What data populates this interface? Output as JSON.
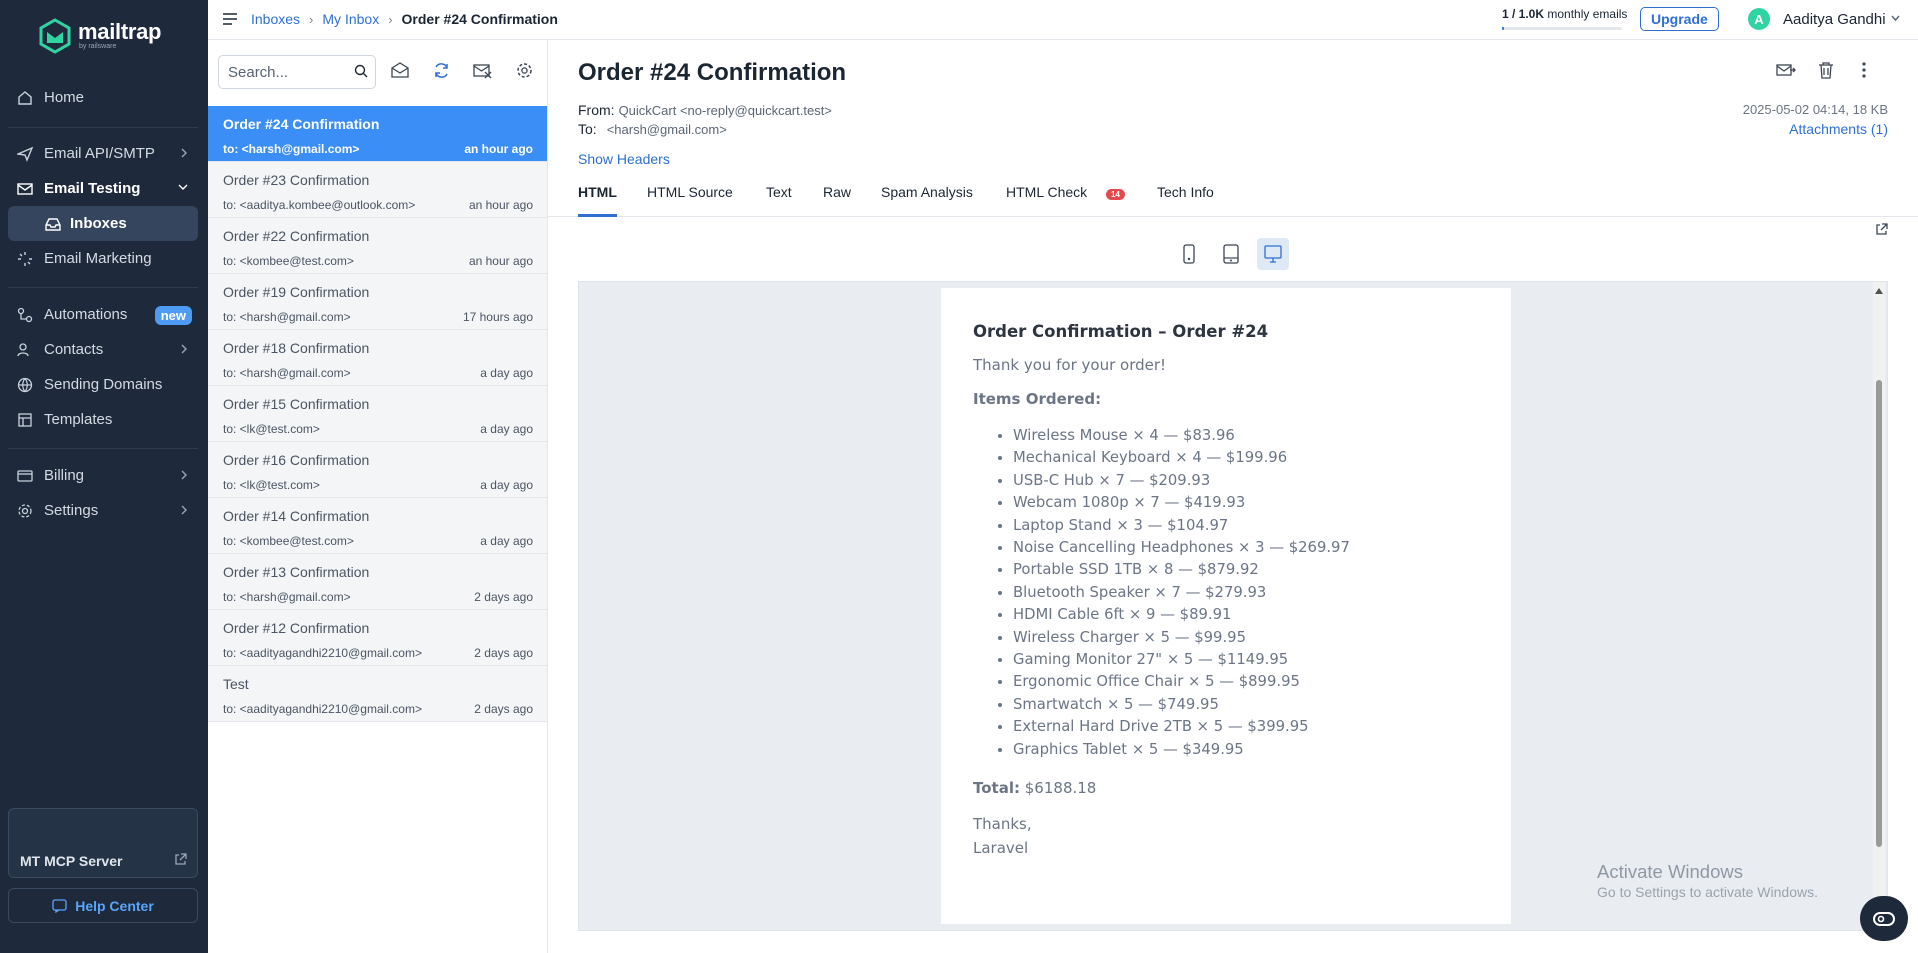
{
  "app": {
    "brand": "mailtrap",
    "brand_sub": "by railsware"
  },
  "sidebar": {
    "items": [
      {
        "label": "Home",
        "icon": "home-icon"
      },
      {
        "label": "Email API/SMTP",
        "icon": "send-icon"
      },
      {
        "label": "Email Testing",
        "icon": "email-testing-icon"
      },
      {
        "label": "Inboxes",
        "icon": "inbox-icon"
      },
      {
        "label": "Email Marketing",
        "icon": "marketing-icon"
      },
      {
        "label": "Automations",
        "icon": "automation-icon",
        "badge": "new"
      },
      {
        "label": "Contacts",
        "icon": "contacts-icon"
      },
      {
        "label": "Sending Domains",
        "icon": "globe-icon"
      },
      {
        "label": "Templates",
        "icon": "template-icon"
      },
      {
        "label": "Billing",
        "icon": "card-icon"
      },
      {
        "label": "Settings",
        "icon": "gear-icon"
      }
    ],
    "mcp_label": "MT MCP Server",
    "help_label": "Help Center"
  },
  "topbar": {
    "breadcrumbs": [
      "Inboxes",
      "My Inbox",
      "Order #24 Confirmation"
    ],
    "quota_used": "1 / 1.0K",
    "quota_unit": "monthly emails",
    "quota_fraction": 0.001,
    "upgrade_label": "Upgrade",
    "avatar_letter": "A",
    "user_name": "Aaditya Gandhi"
  },
  "list": {
    "search_placeholder": "Search...",
    "messages": [
      {
        "subject": "Order #24 Confirmation",
        "to": "to: <harsh@gmail.com>",
        "time": "an hour ago",
        "active": true
      },
      {
        "subject": "Order #23 Confirmation",
        "to": "to: <aaditya.kombee@outlook.com>",
        "time": "an hour ago"
      },
      {
        "subject": "Order #22 Confirmation",
        "to": "to: <kombee@test.com>",
        "time": "an hour ago"
      },
      {
        "subject": "Order #19 Confirmation",
        "to": "to: <harsh@gmail.com>",
        "time": "17 hours ago"
      },
      {
        "subject": "Order #18 Confirmation",
        "to": "to: <harsh@gmail.com>",
        "time": "a day ago"
      },
      {
        "subject": "Order #15 Confirmation",
        "to": "to: <lk@test.com>",
        "time": "a day ago"
      },
      {
        "subject": "Order #16 Confirmation",
        "to": "to: <lk@test.com>",
        "time": "a day ago"
      },
      {
        "subject": "Order #14 Confirmation",
        "to": "to: <kombee@test.com>",
        "time": "a day ago"
      },
      {
        "subject": "Order #13 Confirmation",
        "to": "to: <harsh@gmail.com>",
        "time": "2 days ago"
      },
      {
        "subject": "Order #12 Confirmation",
        "to": "to: <aadityagandhi2210@gmail.com>",
        "time": "2 days ago"
      },
      {
        "subject": "Test",
        "to": "to: <aadityagandhi2210@gmail.com>",
        "time": "2 days ago"
      }
    ]
  },
  "message": {
    "title": "Order #24 Confirmation",
    "from_label": "From:",
    "from": "QuickCart <no-reply@quickcart.test>",
    "to_label": "To:",
    "to": "<harsh@gmail.com>",
    "date": "2025-05-02 04:14, 18 KB",
    "attachments": "Attachments (1)",
    "show_headers": "Show Headers",
    "tabs": [
      {
        "label": "HTML"
      },
      {
        "label": "HTML Source"
      },
      {
        "label": "Text"
      },
      {
        "label": "Raw"
      },
      {
        "label": "Spam Analysis"
      },
      {
        "label": "HTML Check",
        "badge": "14"
      },
      {
        "label": "Tech Info"
      }
    ]
  },
  "email_body": {
    "heading": "Order Confirmation – Order #24",
    "thanks": "Thank you for your order!",
    "items_heading": "Items Ordered:",
    "items": [
      "Wireless Mouse × 4 — $83.96",
      "Mechanical Keyboard × 4 — $199.96",
      "USB-C Hub × 7 — $209.93",
      "Webcam 1080p × 7 — $419.93",
      "Laptop Stand × 3 — $104.97",
      "Noise Cancelling Headphones × 3 — $269.97",
      "Portable SSD 1TB × 8 — $879.92",
      "Bluetooth Speaker × 7 — $279.93",
      "HDMI Cable 6ft × 9 — $89.91",
      "Wireless Charger × 5 — $99.95",
      "Gaming Monitor 27\" × 5 — $1149.95",
      "Ergonomic Office Chair × 5 — $899.95",
      "Smartwatch × 5 — $749.95",
      "External Hard Drive 2TB × 5 — $399.95",
      "Graphics Tablet × 5 — $349.95"
    ],
    "total_label": "Total:",
    "total_value": "$6188.18",
    "sign_1": "Thanks,",
    "sign_2": "Laravel"
  },
  "watermark": {
    "line1": "Activate Windows",
    "line2": "Go to Settings to activate Windows."
  },
  "colors": {
    "sidebar": "#1e2a3b",
    "accent": "#2f6fd3",
    "active_row": "#3b8ef5",
    "badge_new": "#4d9bf5",
    "badge_alert": "#e5484d"
  }
}
